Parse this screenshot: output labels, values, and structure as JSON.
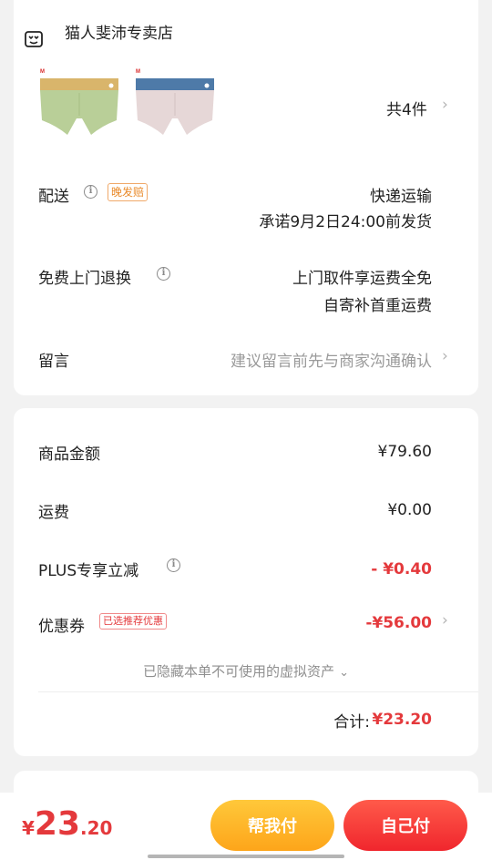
{
  "store": {
    "name": "猫人斐沛专卖店"
  },
  "items": {
    "count_label": "共4件",
    "brand_mark": "MIIOW"
  },
  "delivery": {
    "label": "配送",
    "badge": "晚发赔",
    "method": "快递运输",
    "promise": "承诺9月2日24:00前发货"
  },
  "returns": {
    "label": "免费上门退换",
    "line1": "上门取件享运费全免",
    "line2": "自寄补首重运费"
  },
  "message": {
    "label": "留言",
    "placeholder": "建议留言前先与商家沟通确认"
  },
  "summary": {
    "goods_label": "商品金额",
    "goods_value": "¥79.60",
    "shipping_label": "运费",
    "shipping_value": "¥0.00",
    "plus_label": "PLUS专享立减",
    "plus_value": "- ¥0.40",
    "coupon_label": "优惠券",
    "coupon_badge": "已选推荐优惠",
    "coupon_value": "-¥56.00",
    "hidden_assets": "已隐藏本单不可使用的虚拟资产",
    "total_label": "合计:",
    "total_value": "¥23.20"
  },
  "footer": {
    "currency": "¥",
    "price_int": "23",
    "price_dec": ".20",
    "help_pay": "帮我付",
    "self_pay": "自己付"
  },
  "colors": {
    "accent_red": "#e4393c",
    "badge_orange": "#e98a2a",
    "pay_yellow": "#fdb32a"
  }
}
